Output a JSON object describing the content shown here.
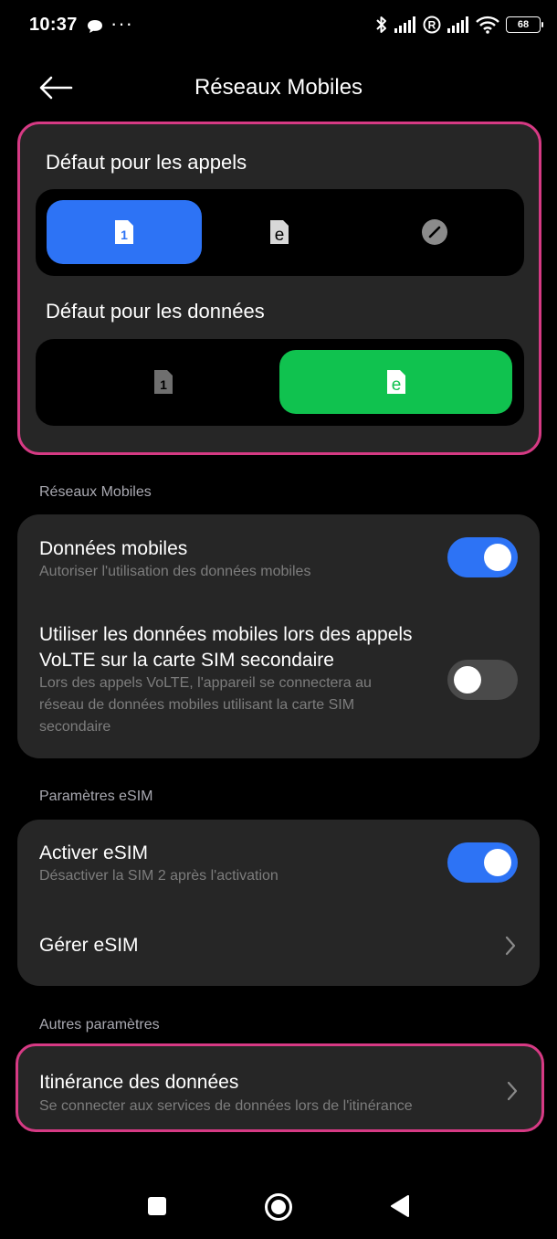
{
  "status_bar": {
    "time": "10:37",
    "battery": "68"
  },
  "header": {
    "title": "Réseaux Mobiles"
  },
  "defaults": {
    "calls_title": "Défaut pour les appels",
    "calls_options": [
      {
        "label": "1",
        "selected": true
      },
      {
        "label": "e",
        "selected": false
      },
      {
        "label": "ask",
        "selected": false
      }
    ],
    "data_title": "Défaut pour les données",
    "data_options": [
      {
        "label": "1",
        "selected": false
      },
      {
        "label": "e",
        "selected": true
      }
    ]
  },
  "mobile_networks": {
    "section_label": "Réseaux Mobiles",
    "mobile_data": {
      "title": "Données mobiles",
      "subtitle": "Autoriser l'utilisation des données mobiles",
      "on": true
    },
    "volte_data": {
      "title_line1": "Utiliser les données mobiles lors des appels",
      "title_line2": "VoLTE sur la carte SIM secondaire",
      "sub_line1": "Lors des appels VoLTE, l'appareil se connectera au",
      "sub_line2": "réseau de données mobiles utilisant la carte SIM",
      "sub_line3": "secondaire",
      "on": false
    }
  },
  "esim": {
    "section_label": "Paramètres eSIM",
    "activate": {
      "title": "Activer eSIM",
      "subtitle": "Désactiver la SIM 2 après l'activation",
      "on": true
    },
    "manage": {
      "title": "Gérer eSIM"
    }
  },
  "other": {
    "section_label": "Autres paramètres",
    "roaming": {
      "title": "Itinérance des données",
      "subtitle": "Se connecter aux services de données lors de l'itinérance"
    }
  },
  "colors": {
    "accent_blue": "#2d73f5",
    "accent_green": "#10c24f",
    "highlight": "#d63a84",
    "card": "#262626"
  },
  "icons": [
    "sim-1-icon",
    "esim-icon",
    "ask-every-time-icon",
    "chevron-right-icon",
    "back-arrow-icon"
  ]
}
